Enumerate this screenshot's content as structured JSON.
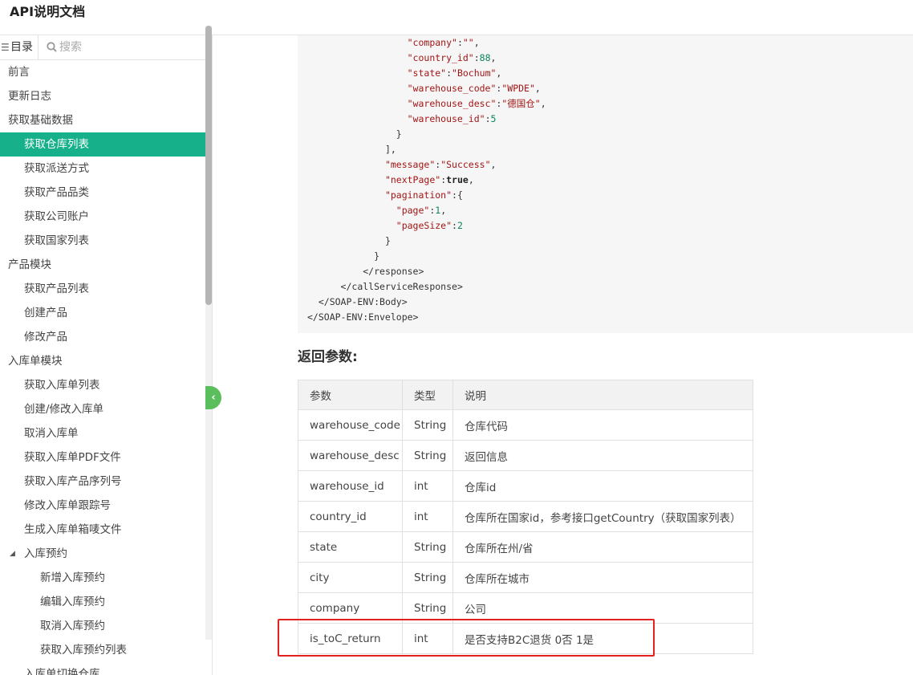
{
  "header": {
    "title": "API说明文档"
  },
  "sidebar": {
    "toc_label": "目录",
    "search_placeholder": "搜索",
    "items": [
      {
        "label": "前言",
        "level": 1
      },
      {
        "label": "更新日志",
        "level": 1
      },
      {
        "label": "获取基础数据",
        "level": 1
      },
      {
        "label": "获取仓库列表",
        "level": 2,
        "active": true
      },
      {
        "label": "获取派送方式",
        "level": 2
      },
      {
        "label": "获取产品品类",
        "level": 2
      },
      {
        "label": "获取公司账户",
        "level": 2
      },
      {
        "label": "获取国家列表",
        "level": 2
      },
      {
        "label": "产品模块",
        "level": 1
      },
      {
        "label": "获取产品列表",
        "level": 2
      },
      {
        "label": "创建产品",
        "level": 2
      },
      {
        "label": "修改产品",
        "level": 2
      },
      {
        "label": "入库单模块",
        "level": 1
      },
      {
        "label": "获取入库单列表",
        "level": 2
      },
      {
        "label": "创建/修改入库单",
        "level": 2
      },
      {
        "label": "取消入库单",
        "level": 2
      },
      {
        "label": "获取入库单PDF文件",
        "level": 2
      },
      {
        "label": "获取入库产品序列号",
        "level": 2
      },
      {
        "label": "修改入库单跟踪号",
        "level": 2
      },
      {
        "label": "生成入库单箱唛文件",
        "level": 2
      },
      {
        "label": "入库预约",
        "level": 2,
        "expanded": true
      },
      {
        "label": "新增入库预约",
        "level": 3
      },
      {
        "label": "编辑入库预约",
        "level": 3
      },
      {
        "label": "取消入库预约",
        "level": 3
      },
      {
        "label": "获取入库预约列表",
        "level": 3
      },
      {
        "label": "入库单切换仓库",
        "level": 2
      }
    ]
  },
  "code": {
    "lines": [
      [
        {
          "indent": "                  "
        },
        {
          "c": "k",
          "v": "\"company\""
        },
        {
          "c": "t",
          "v": ":"
        },
        {
          "c": "s",
          "v": "\"\""
        },
        {
          "c": "t",
          "v": ","
        }
      ],
      [
        {
          "indent": "                  "
        },
        {
          "c": "k",
          "v": "\"country_id\""
        },
        {
          "c": "t",
          "v": ":"
        },
        {
          "c": "n",
          "v": "88"
        },
        {
          "c": "t",
          "v": ","
        }
      ],
      [
        {
          "indent": "                  "
        },
        {
          "c": "k",
          "v": "\"state\""
        },
        {
          "c": "t",
          "v": ":"
        },
        {
          "c": "s",
          "v": "\"Bochum\""
        },
        {
          "c": "t",
          "v": ","
        }
      ],
      [
        {
          "indent": "                  "
        },
        {
          "c": "k",
          "v": "\"warehouse_code\""
        },
        {
          "c": "t",
          "v": ":"
        },
        {
          "c": "s",
          "v": "\"WPDE\""
        },
        {
          "c": "t",
          "v": ","
        }
      ],
      [
        {
          "indent": "                  "
        },
        {
          "c": "k",
          "v": "\"warehouse_desc\""
        },
        {
          "c": "t",
          "v": ":"
        },
        {
          "c": "s",
          "v": "\"德国仓\""
        },
        {
          "c": "t",
          "v": ","
        }
      ],
      [
        {
          "indent": "                  "
        },
        {
          "c": "k",
          "v": "\"warehouse_id\""
        },
        {
          "c": "t",
          "v": ":"
        },
        {
          "c": "n",
          "v": "5"
        }
      ],
      [
        {
          "indent": "                "
        },
        {
          "c": "t",
          "v": "}"
        }
      ],
      [
        {
          "indent": "              "
        },
        {
          "c": "t",
          "v": "],"
        }
      ],
      [
        {
          "indent": "              "
        },
        {
          "c": "k",
          "v": "\"message\""
        },
        {
          "c": "t",
          "v": ":"
        },
        {
          "c": "s",
          "v": "\"Success\""
        },
        {
          "c": "t",
          "v": ","
        }
      ],
      [
        {
          "indent": "              "
        },
        {
          "c": "k",
          "v": "\"nextPage\""
        },
        {
          "c": "t",
          "v": ":"
        },
        {
          "c": "b",
          "v": "true"
        },
        {
          "c": "t",
          "v": ","
        }
      ],
      [
        {
          "indent": "              "
        },
        {
          "c": "k",
          "v": "\"pagination\""
        },
        {
          "c": "t",
          "v": ":{"
        }
      ],
      [
        {
          "indent": "                "
        },
        {
          "c": "k",
          "v": "\"page\""
        },
        {
          "c": "t",
          "v": ":"
        },
        {
          "c": "n",
          "v": "1"
        },
        {
          "c": "t",
          "v": ","
        }
      ],
      [
        {
          "indent": "                "
        },
        {
          "c": "k",
          "v": "\"pageSize\""
        },
        {
          "c": "t",
          "v": ":"
        },
        {
          "c": "n",
          "v": "2"
        }
      ],
      [
        {
          "indent": "              "
        },
        {
          "c": "t",
          "v": "}"
        }
      ],
      [
        {
          "indent": "            "
        },
        {
          "c": "t",
          "v": "}"
        }
      ],
      [
        {
          "indent": "          "
        },
        {
          "c": "t",
          "v": "</response>"
        }
      ],
      [
        {
          "indent": "      "
        },
        {
          "c": "t",
          "v": "</callServiceResponse>"
        }
      ],
      [
        {
          "indent": "  "
        },
        {
          "c": "t",
          "v": "</SOAP-ENV:Body>"
        }
      ],
      [
        {
          "indent": ""
        },
        {
          "c": "t",
          "v": "</SOAP-ENV:Envelope>"
        }
      ]
    ]
  },
  "section": {
    "title": "返回参数:"
  },
  "table": {
    "headers": [
      "参数",
      "类型",
      "说明"
    ],
    "rows": [
      [
        "warehouse_code",
        "String",
        "仓库代码"
      ],
      [
        "warehouse_desc",
        "String",
        "返回信息"
      ],
      [
        "warehouse_id",
        "int",
        "仓库id"
      ],
      [
        "country_id",
        "int",
        "仓库所在国家id，参考接口getCountry（获取国家列表）"
      ],
      [
        "state",
        "String",
        "仓库所在州/省"
      ],
      [
        "city",
        "String",
        "仓库所在城市"
      ],
      [
        "company",
        "String",
        "公司"
      ],
      [
        "is_toC_return",
        "int",
        "是否支持B2C退货 0否 1是"
      ]
    ]
  },
  "colors": {
    "accent": "#16b08a",
    "highlight": "#e3211f",
    "collapse": "#5bbe5c"
  }
}
